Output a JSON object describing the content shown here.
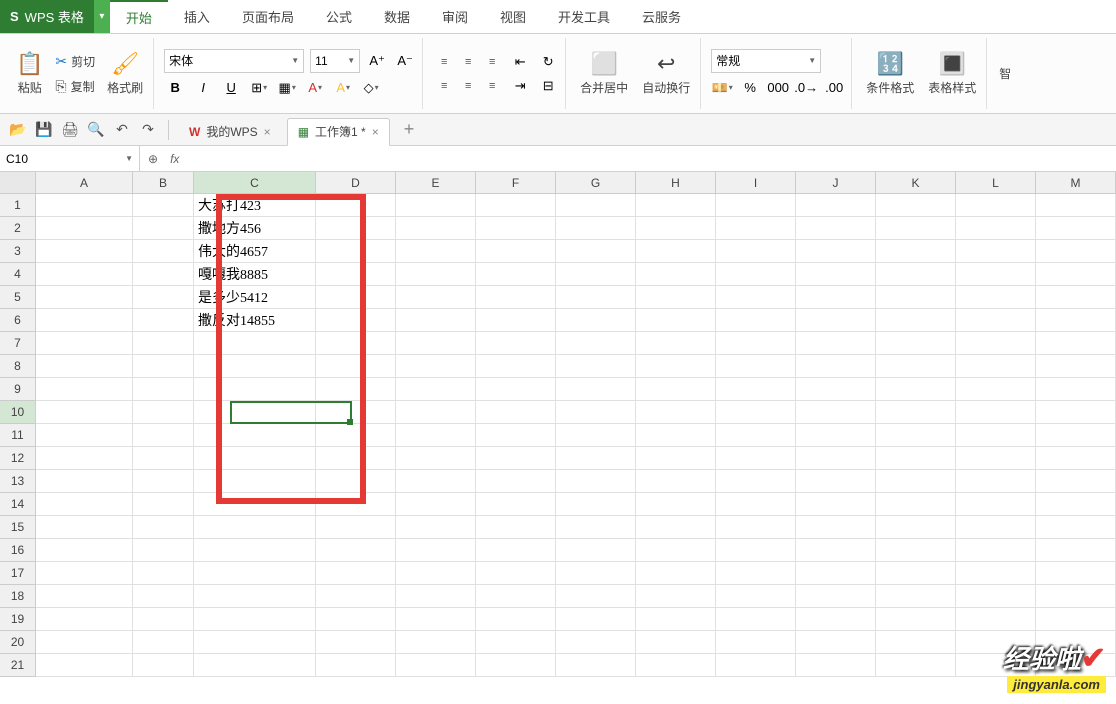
{
  "app": {
    "name": "WPS 表格",
    "badge": "S"
  },
  "menu": {
    "tabs": [
      "开始",
      "插入",
      "页面布局",
      "公式",
      "数据",
      "审阅",
      "视图",
      "开发工具",
      "云服务"
    ],
    "active": 0
  },
  "ribbon": {
    "paste": "粘贴",
    "cut": "剪切",
    "copy": "复制",
    "format_painter": "格式刷",
    "font_name": "宋体",
    "font_size": "11",
    "bold": "B",
    "italic": "I",
    "underline": "U",
    "merge_center": "合并居中",
    "wrap_text": "自动换行",
    "number_format": "常规",
    "cond_format": "条件格式",
    "table_style": "表格样式",
    "extra": "智"
  },
  "doc_tabs": {
    "wps_home": "我的WPS",
    "workbook": "工作簿1 *"
  },
  "name_box": "C10",
  "columns": [
    "A",
    "B",
    "C",
    "D",
    "E",
    "F",
    "G",
    "H",
    "I",
    "J",
    "K",
    "L",
    "M"
  ],
  "rows": [
    "1",
    "2",
    "3",
    "4",
    "5",
    "6",
    "7",
    "8",
    "9",
    "10",
    "11",
    "12",
    "13",
    "14",
    "15",
    "16",
    "17",
    "18",
    "19",
    "20",
    "21"
  ],
  "cells": {
    "C1": "大苏打423",
    "C2": "撒地方456",
    "C3": "伟大的4657",
    "C4": "嘎嘎我8885",
    "C5": "是多少5412",
    "C6": "撒反对14855"
  },
  "selected_cell": "C10",
  "watermark": {
    "line1": "经验啦",
    "line2": "jingyanla.com"
  }
}
